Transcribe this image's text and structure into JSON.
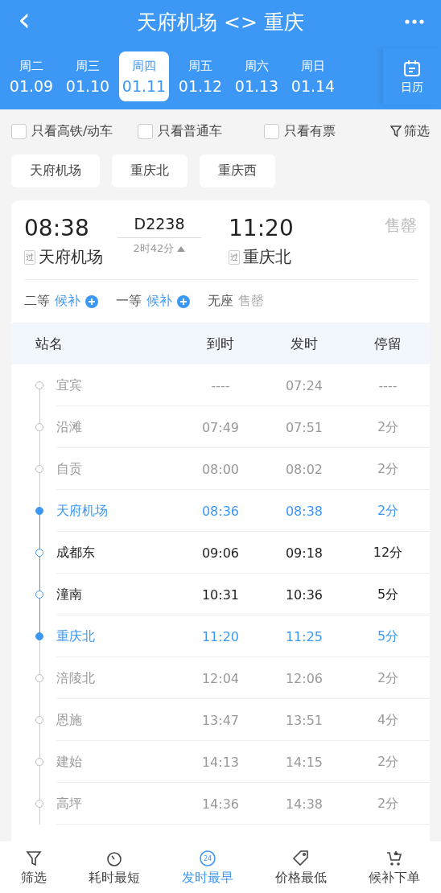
{
  "header": {
    "title": "天府机场 <> 重庆",
    "back": "‹"
  },
  "dates": [
    {
      "weekday": "周二",
      "date": "01.09",
      "selected": false
    },
    {
      "weekday": "周三",
      "date": "01.10",
      "selected": false
    },
    {
      "weekday": "周四",
      "date": "01.11",
      "selected": true
    },
    {
      "weekday": "周五",
      "date": "01.12",
      "selected": false
    },
    {
      "weekday": "周六",
      "date": "01.13",
      "selected": false
    },
    {
      "weekday": "周日",
      "date": "01.14",
      "selected": false
    }
  ],
  "calendar_button": "日历",
  "filters": [
    {
      "label": "只看高铁/动车",
      "checked": false
    },
    {
      "label": "只看普通车",
      "checked": false
    },
    {
      "label": "只看有票",
      "checked": false
    }
  ],
  "filter_button": "筛选",
  "stations": [
    "天府机场",
    "重庆北",
    "重庆西"
  ],
  "train": {
    "depart_time": "08:38",
    "depart_station": "天府机场",
    "depart_tag": "过",
    "number": "D2238",
    "duration": "2时42分",
    "expanded": true,
    "arrive_time": "11:20",
    "arrive_station": "重庆北",
    "arrive_tag": "过",
    "status": "售罄",
    "seats": [
      {
        "class": "二等",
        "status": "候补",
        "waitlist": true
      },
      {
        "class": "一等",
        "status": "候补",
        "waitlist": true
      },
      {
        "class": "无座",
        "status": "售罄",
        "waitlist": false
      }
    ]
  },
  "stops_table": {
    "columns": [
      "站名",
      "到时",
      "发时",
      "停留"
    ],
    "rows": [
      {
        "kind": "outside",
        "station": "宜宾",
        "arrive": "----",
        "depart": "07:24",
        "stay": "----"
      },
      {
        "kind": "outside",
        "station": "沿滩",
        "arrive": "07:49",
        "depart": "07:51",
        "stay": "2分"
      },
      {
        "kind": "outside",
        "station": "自贡",
        "arrive": "08:00",
        "depart": "08:02",
        "stay": "2分"
      },
      {
        "kind": "endpoint",
        "station": "天府机场",
        "arrive": "08:36",
        "depart": "08:38",
        "stay": "2分"
      },
      {
        "kind": "inside",
        "station": "成都东",
        "arrive": "09:06",
        "depart": "09:18",
        "stay": "12分"
      },
      {
        "kind": "inside",
        "station": "潼南",
        "arrive": "10:31",
        "depart": "10:36",
        "stay": "5分"
      },
      {
        "kind": "endpoint",
        "station": "重庆北",
        "arrive": "11:20",
        "depart": "11:25",
        "stay": "5分"
      },
      {
        "kind": "outside",
        "station": "涪陵北",
        "arrive": "12:04",
        "depart": "12:06",
        "stay": "2分"
      },
      {
        "kind": "outside",
        "station": "恩施",
        "arrive": "13:47",
        "depart": "13:51",
        "stay": "4分"
      },
      {
        "kind": "outside",
        "station": "建始",
        "arrive": "14:13",
        "depart": "14:15",
        "stay": "2分"
      },
      {
        "kind": "outside",
        "station": "高坪",
        "arrive": "14:36",
        "depart": "14:38",
        "stay": "2分"
      }
    ]
  },
  "bottom_nav": [
    {
      "kind": "filter",
      "label": "筛选",
      "selected": false
    },
    {
      "kind": "duration",
      "label": "耗时最短",
      "selected": false
    },
    {
      "kind": "clock24",
      "label": "发时最早",
      "icon_text": "24",
      "selected": true
    },
    {
      "kind": "price",
      "label": "价格最低",
      "selected": false
    },
    {
      "kind": "cart",
      "label": "候补下单",
      "selected": false
    }
  ]
}
